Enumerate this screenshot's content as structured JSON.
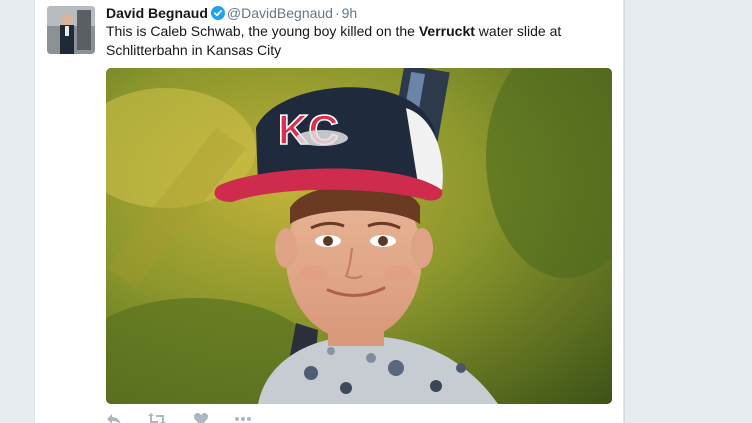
{
  "tweet": {
    "display_name": "David Begnaud",
    "handle": "@DavidBegnaud",
    "separator": "·",
    "timestamp": "9h",
    "text_before": "This is Caleb Schwab, the young boy killed on the ",
    "text_bold": "Verruckt",
    "text_after": " water slide at Schlitterbahn in Kansas City",
    "verified": true,
    "avatar_icon": "profile-photo-icon",
    "media_icon": "tweet-photo",
    "cap_logo": "KC"
  },
  "actions": {
    "reply_icon": "reply-icon",
    "retweet_icon": "retweet-icon",
    "like_icon": "heart-icon",
    "more_icon": "more-icon"
  },
  "colors": {
    "name": "#14171a",
    "meta": "#657786",
    "verified": "#1da1f2",
    "background": "#e6ecf0"
  }
}
